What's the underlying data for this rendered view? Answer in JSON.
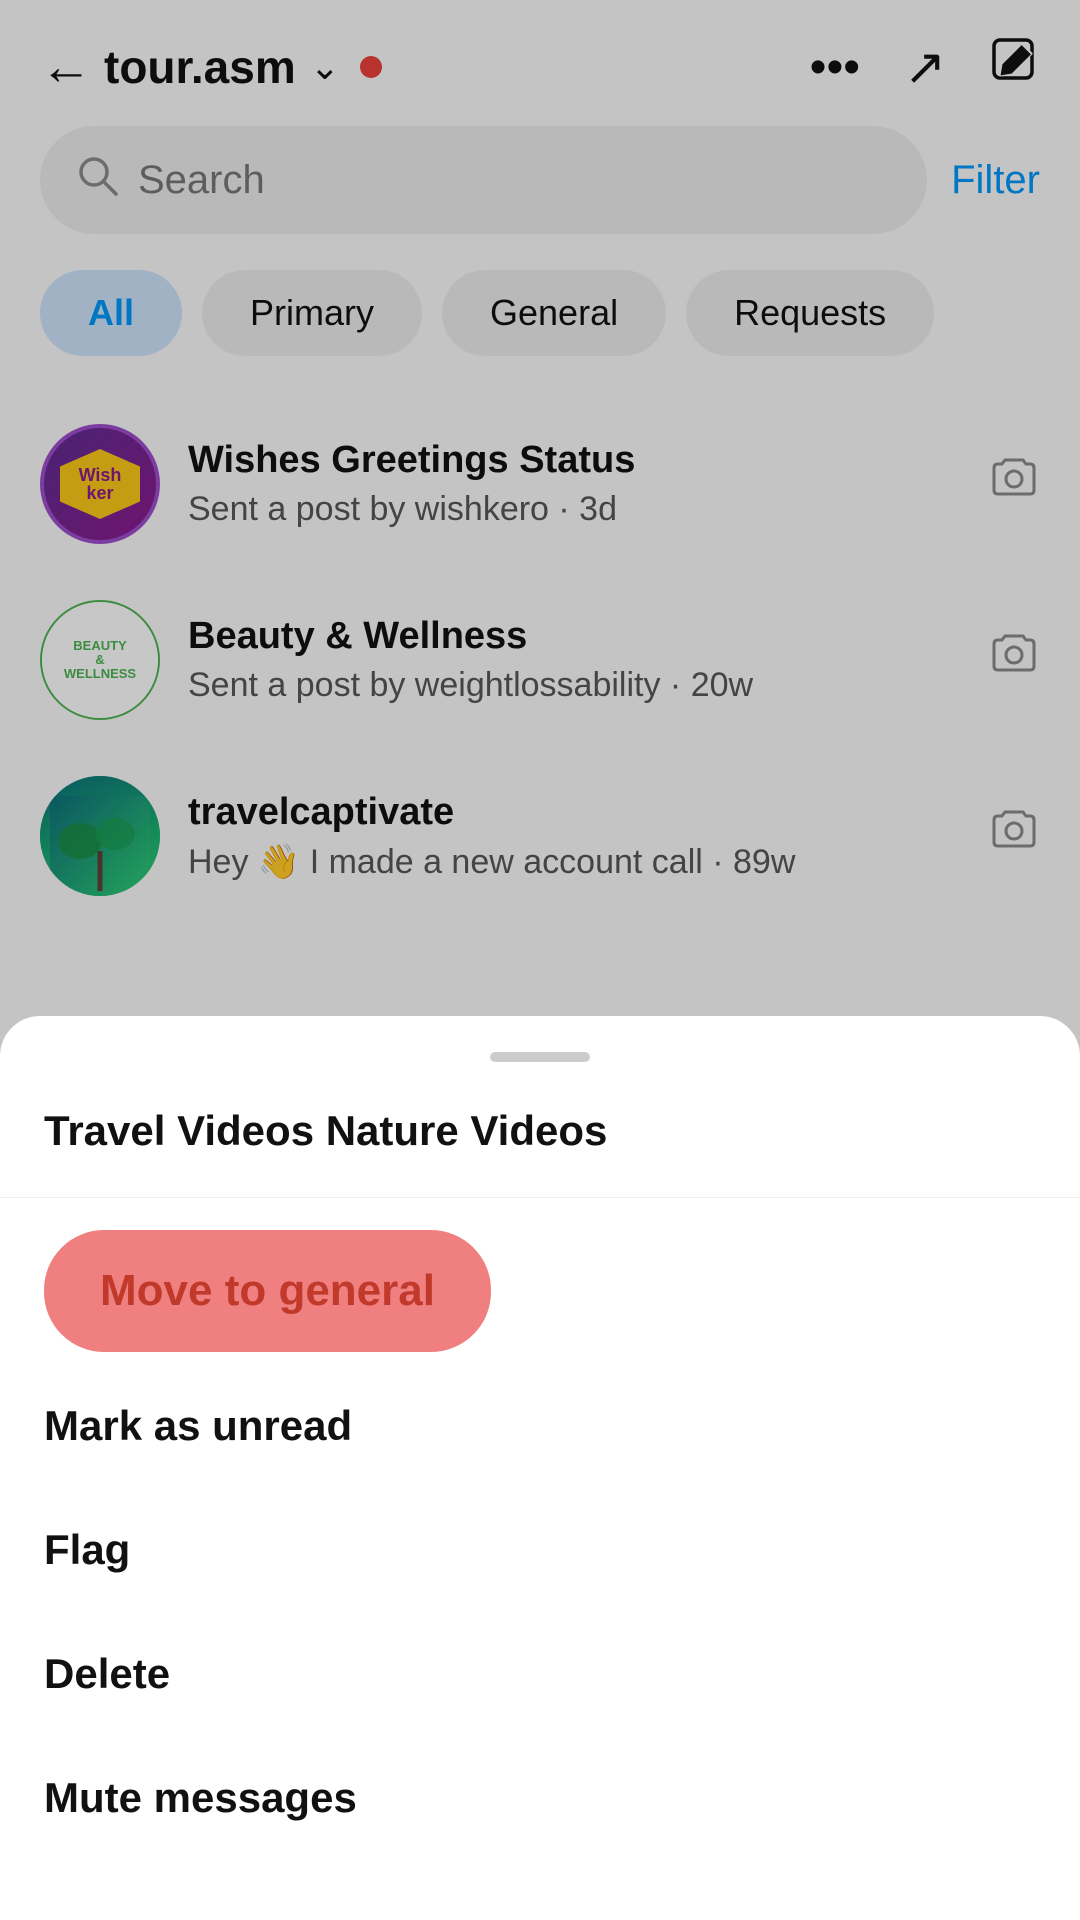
{
  "header": {
    "back_label": "←",
    "title": "tour.asm",
    "chevron": "∨",
    "dot_color": "#e8403a",
    "more_icon": "•••",
    "trending_icon": "↗",
    "compose_icon": "✏"
  },
  "search": {
    "placeholder": "Search",
    "filter_label": "Filter"
  },
  "tabs": [
    {
      "label": "All",
      "active": true
    },
    {
      "label": "Primary",
      "active": false
    },
    {
      "label": "General",
      "active": false
    },
    {
      "label": "Requests",
      "active": false
    }
  ],
  "messages": [
    {
      "id": "wishker",
      "title": "Wishes Greetings Status",
      "preview": "Sent a post by wishkero · 3d"
    },
    {
      "id": "beauty",
      "title": "Beauty & Wellness",
      "preview": "Sent a post by weightlossability · 20w"
    },
    {
      "id": "travel",
      "title": "travelcaptivate",
      "preview": "Hey 👋 I made a new account call · 89w"
    }
  ],
  "bottom_sheet": {
    "categories": "Travel Videos Nature Videos",
    "actions": [
      {
        "id": "move-general",
        "label": "Move to general",
        "highlighted": true
      },
      {
        "id": "mark-unread",
        "label": "Mark as unread",
        "highlighted": false
      },
      {
        "id": "flag",
        "label": "Flag",
        "highlighted": false
      },
      {
        "id": "delete",
        "label": "Delete",
        "highlighted": false
      },
      {
        "id": "mute",
        "label": "Mute messages",
        "highlighted": false
      }
    ]
  }
}
